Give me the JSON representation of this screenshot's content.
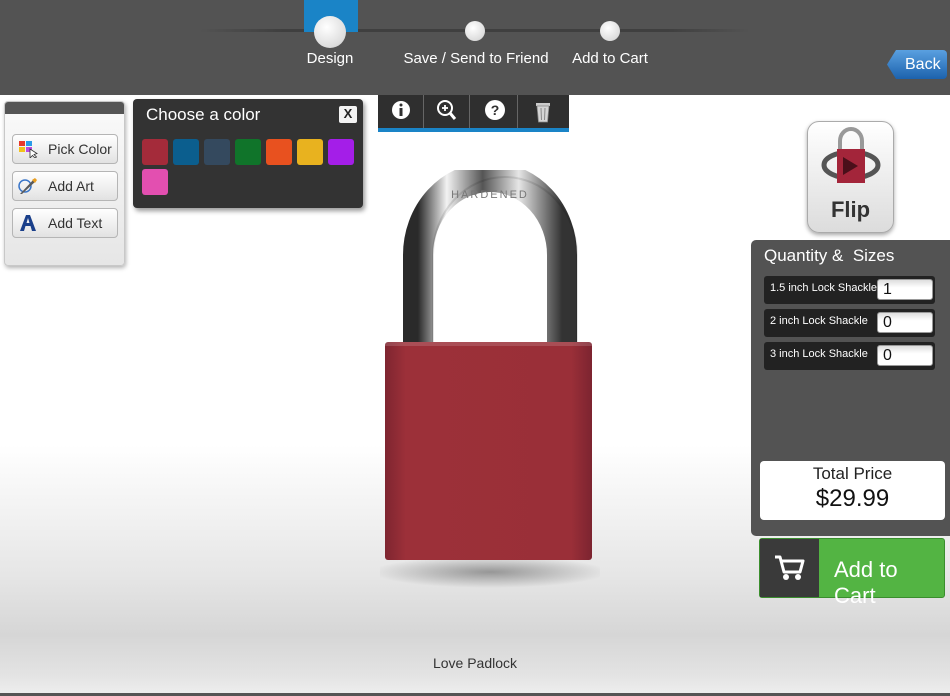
{
  "steps": [
    {
      "label": "Design",
      "active": true
    },
    {
      "label": "Save / Send to Friend",
      "active": false
    },
    {
      "label": "Add to Cart",
      "active": false
    }
  ],
  "back_label": "Back",
  "tools": [
    {
      "label": "Pick Color",
      "icon": "palette-icon"
    },
    {
      "label": "Add Art",
      "icon": "art-brush-icon"
    },
    {
      "label": "Add Text",
      "icon": "text-a-icon"
    }
  ],
  "color_picker": {
    "title": "Choose a color",
    "close_label": "X",
    "swatches": [
      "#a42b3a",
      "#0b5e8e",
      "#34495e",
      "#10742a",
      "#e8511f",
      "#e8b21f",
      "#a41ee8",
      "#e34fb0"
    ]
  },
  "icon_bar": [
    "info-icon",
    "zoom-in-icon",
    "help-icon",
    "trash-icon"
  ],
  "lock": {
    "body_color": "#962f38",
    "shackle_text": "HARDENED"
  },
  "flip_label": "Flip",
  "quantity": {
    "title": "Quantity &  Sizes",
    "rows": [
      {
        "label": "1.5 inch Lock Shackle",
        "value": "1"
      },
      {
        "label": "2 inch Lock Shackle",
        "value": "0"
      },
      {
        "label": "3 inch Lock Shackle",
        "value": "0"
      }
    ]
  },
  "total": {
    "label": "Total Price",
    "value": "$29.99"
  },
  "add_to_cart_label": "Add to Cart",
  "product_name": "Love Padlock",
  "colors": {
    "accent_blue": "#1a84c7",
    "cart_green": "#53b443",
    "topbar": "#535353"
  }
}
